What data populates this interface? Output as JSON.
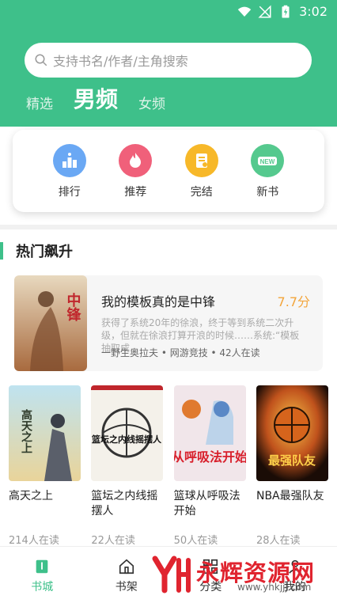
{
  "status": {
    "time": "3:02"
  },
  "search": {
    "placeholder": "支持书名/作者/主角搜索"
  },
  "tabs": [
    {
      "label": "精选",
      "active": false
    },
    {
      "label": "男频",
      "active": true
    },
    {
      "label": "女频",
      "active": false
    }
  ],
  "quick": [
    {
      "label": "排行",
      "icon": "ranking-icon",
      "color": "#6aa8f4"
    },
    {
      "label": "推荐",
      "icon": "fire-icon",
      "color": "#f0607a"
    },
    {
      "label": "完结",
      "icon": "finished-icon",
      "color": "#f7b829"
    },
    {
      "label": "新书",
      "icon": "new-book-icon",
      "color": "#55c98e"
    }
  ],
  "section": {
    "title": "热门飙升"
  },
  "feature": {
    "title": "我的模板真的是中锋",
    "score": "7.7分",
    "desc": "获得了系统20年的徐浪，终于等到系统二次升级，但就在徐浪打算开浪的时候……系统:“模板抽取成...",
    "meta": "一野生奥拉夫 • 网游竞技 • 42人在读",
    "cover_text": "中锋"
  },
  "books": [
    {
      "name": "高天之上",
      "read": "214人在读",
      "cover_text": "高天之上"
    },
    {
      "name": "篮坛之内线摇摆人",
      "read": "22人在读",
      "cover_text": "篮坛之内线摇摆人"
    },
    {
      "name": "篮球从呼吸法开始",
      "read": "50人在读",
      "cover_text": "从呼吸法开始"
    },
    {
      "name": "NBA最强队友",
      "read": "28人在读",
      "cover_text": "最强队友"
    }
  ],
  "bottom_nav": [
    {
      "label": "书城",
      "icon": "bookstore-icon",
      "active": true
    },
    {
      "label": "书架",
      "icon": "bookshelf-icon",
      "active": false
    },
    {
      "label": "分类",
      "icon": "category-icon",
      "active": false
    },
    {
      "label": "我的",
      "icon": "profile-icon",
      "active": false
    }
  ],
  "watermark": {
    "text": "永辉资源网",
    "url": "www.yhkjjj.com"
  },
  "colors": {
    "accent": "#3ec08a",
    "score": "#f3a53b",
    "watermark": "#e0242f"
  }
}
